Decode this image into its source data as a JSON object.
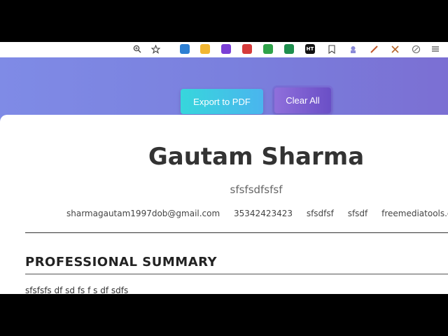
{
  "toolbar": {
    "icons": [
      "zoom-icon",
      "star-icon"
    ],
    "extensions": [
      {
        "name": "ext-blue",
        "color": "#2d7fd3",
        "text": ""
      },
      {
        "name": "ext-yellow",
        "color": "#f2b632",
        "text": ""
      },
      {
        "name": "ext-purple",
        "color": "#7a3fd6",
        "text": ""
      },
      {
        "name": "ext-red-shield",
        "color": "#d63b3b",
        "text": ""
      },
      {
        "name": "ext-green",
        "color": "#2fa34a",
        "text": ""
      },
      {
        "name": "ext-sheets",
        "color": "#1e8f4e",
        "text": ""
      },
      {
        "name": "ext-ht",
        "color": "#111111",
        "text": "HT"
      }
    ]
  },
  "actions": {
    "export_label": "Export to PDF",
    "clear_label": "Clear All"
  },
  "resume": {
    "name": "Gautam Sharma",
    "subtitle": "sfsfsdfsfsf",
    "contacts": {
      "email": "sharmagautam1997dob@gmail.com",
      "phone": "35342423423",
      "field3": "sfsdfsf",
      "field4": "sfsdf",
      "website": "freemediatools.com"
    },
    "summary_title": "PROFESSIONAL SUMMARY",
    "summary_text": "sfsfsfs df sd fs f s df sdfs"
  },
  "colors": {
    "hero_start": "#7f8be6",
    "hero_end": "#7b6fd3",
    "export_start": "#37d6dc",
    "export_end": "#4ab5ee",
    "clear_start": "#8f6fdb",
    "clear_end": "#6a4fc6"
  }
}
